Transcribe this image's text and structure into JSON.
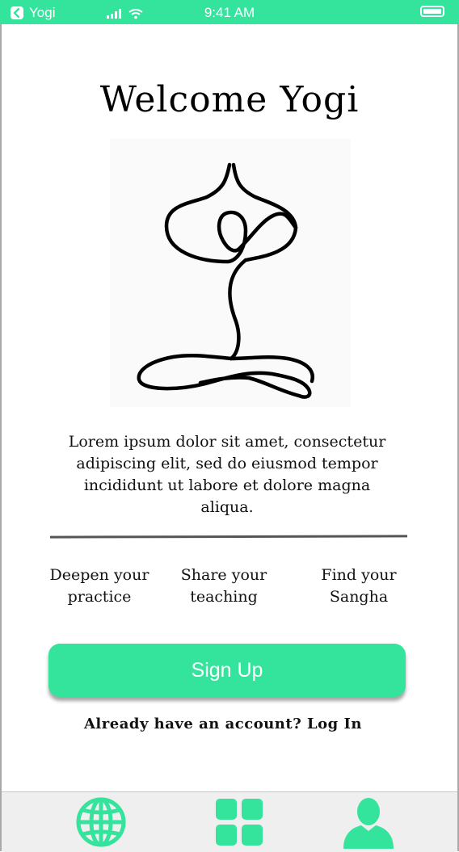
{
  "status_bar": {
    "app_name": "Yogi",
    "time": "9:41 AM",
    "back_icon": "chevron-left-icon",
    "signal_icon": "cellular-signal-icon",
    "wifi_icon": "wifi-icon",
    "battery_icon": "battery-icon",
    "battery_level": 1.0
  },
  "welcome": {
    "title": "Welcome Yogi",
    "illustration_icon": "meditating-yogi-line-art-icon",
    "description": "Lorem ipsum dolor sit amet, consectetur adipiscing elit, sed do eiusmod tempor incididunt ut labore et dolore magna aliqua."
  },
  "features": [
    {
      "line1": "Deepen your",
      "line2": "practice"
    },
    {
      "line1": "Share your",
      "line2": "teaching"
    },
    {
      "line1": "Find your",
      "line2": "Sangha"
    }
  ],
  "actions": {
    "signup_label": "Sign Up",
    "login_text": "Already have an account? Log In"
  },
  "tab_bar": {
    "tabs": [
      {
        "icon": "globe-icon"
      },
      {
        "icon": "grid-icon"
      },
      {
        "icon": "user-profile-icon"
      }
    ]
  },
  "colors": {
    "accent": "#34e39c",
    "tab_bar_bg": "#efefef",
    "text": "#111111"
  }
}
